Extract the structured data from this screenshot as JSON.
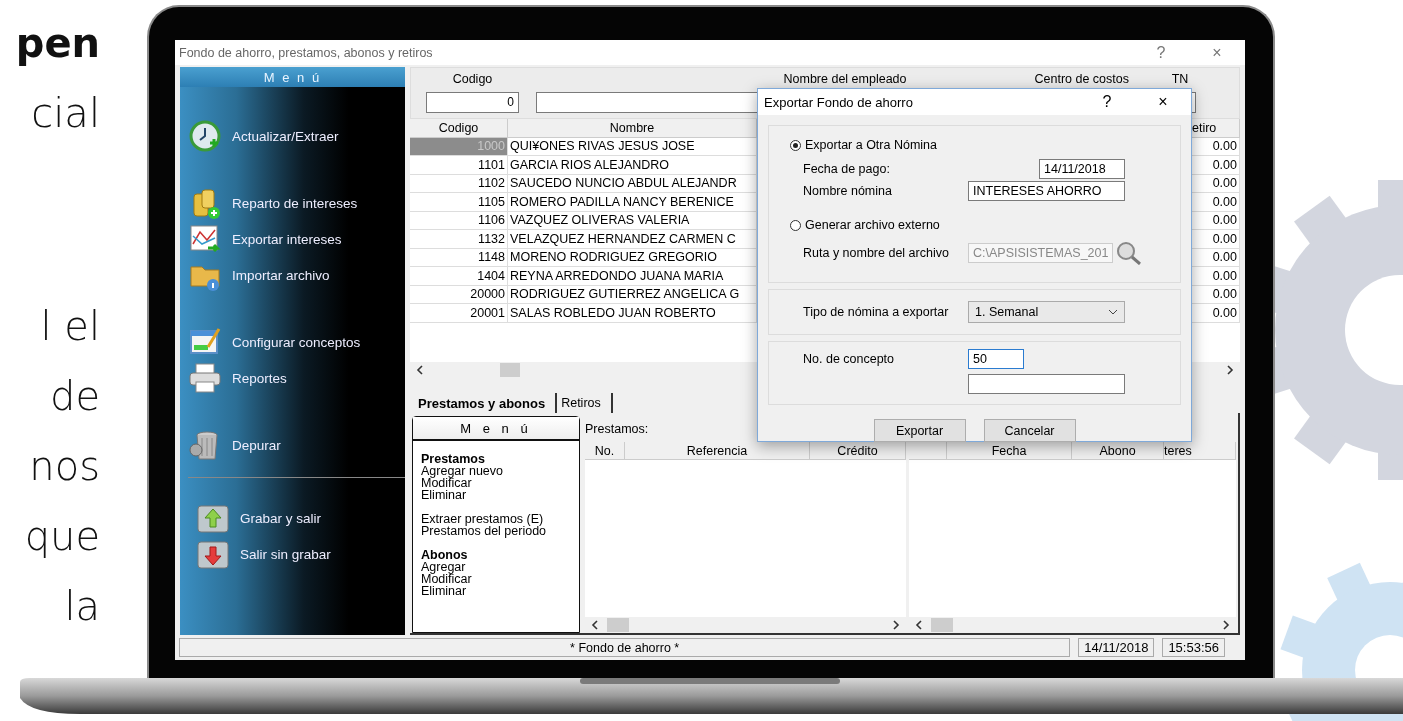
{
  "side_text": {
    "top_lines": [
      "pen",
      "cial"
    ],
    "bottom_lines": [
      "l el",
      "de",
      "nos",
      "que",
      "la"
    ]
  },
  "window": {
    "title": "Fondo de ahorro, prestamos, abonos y retiros",
    "help": "?",
    "close": "×"
  },
  "left_menu": {
    "title": "M e n ú",
    "groups": [
      {
        "separated": false,
        "items": [
          "Actualizar/Extraer"
        ]
      },
      {
        "separated": false,
        "items": [
          "Reparto de intereses",
          "Exportar intereses",
          "Importar archivo"
        ]
      },
      {
        "separated": false,
        "items": [
          "Configurar conceptos",
          "Reportes"
        ]
      },
      {
        "separated": false,
        "items": [
          "Depurar"
        ]
      },
      {
        "separated": true,
        "items": [
          "Grabar y salir",
          "Salir sin grabar"
        ]
      }
    ]
  },
  "employee_filter": [
    {
      "label": "Codigo",
      "value": "0"
    },
    {
      "label": "Nombre del empleado"
    },
    {
      "label": "Centro de costos"
    },
    {
      "label": "TN"
    }
  ],
  "employees": {
    "columns": [
      "Codigo",
      "Nombre",
      "etiro"
    ],
    "rows": [
      {
        "code": "1000",
        "name": "QUI¥ONES RIVAS JESUS JOSE",
        "retiro": "0.00",
        "selected": true
      },
      {
        "code": "1101",
        "name": "GARCIA RIOS ALEJANDRO",
        "retiro": "0.00",
        "selected": false
      },
      {
        "code": "1102",
        "name": "SAUCEDO NUNCIO ABDUL ALEJANDR",
        "retiro": "0.00",
        "selected": false
      },
      {
        "code": "1105",
        "name": "ROMERO PADILLA NANCY BERENICE",
        "retiro": "0.00",
        "selected": false
      },
      {
        "code": "1106",
        "name": "VAZQUEZ OLIVERAS VALERIA",
        "retiro": "0.00",
        "selected": false
      },
      {
        "code": "1132",
        "name": "VELAZQUEZ HERNANDEZ CARMEN C",
        "retiro": "0.00",
        "selected": false
      },
      {
        "code": "1148",
        "name": "MORENO RODRIGUEZ GREGORIO",
        "retiro": "0.00",
        "selected": false
      },
      {
        "code": "1404",
        "name": "REYNA ARREDONDO JUANA MARIA",
        "retiro": "0.00",
        "selected": false
      },
      {
        "code": "20000",
        "name": "RODRIGUEZ GUTIERREZ ANGELICA G",
        "retiro": "0.00",
        "selected": false
      },
      {
        "code": "20001",
        "name": "SALAS ROBLEDO JUAN ROBERTO",
        "retiro": "0.00",
        "selected": false
      }
    ]
  },
  "tabs": [
    {
      "label": "Prestamos y abonos",
      "selected": true
    },
    {
      "label": "Retiros",
      "selected": false
    }
  ],
  "loans_panel": {
    "menu_title": "M e n ú",
    "menu_groups": [
      {
        "title": "Prestamos",
        "items": [
          "Agregar nuevo",
          "Modificar",
          "Eliminar"
        ]
      },
      {
        "items": [
          "Extraer prestamos (E)",
          "Prestamos del periodo"
        ]
      },
      {
        "title": "Abonos",
        "items": [
          "Agregar",
          "Modificar",
          "Eliminar"
        ]
      }
    ],
    "label": "Prestamos:",
    "loans_columns": [
      "No.",
      "Referencia",
      "Crédito"
    ],
    "payments_columns": [
      "Fecha",
      "Abono",
      "teres"
    ]
  },
  "status_bar": {
    "message": "* Fondo de ahorro *",
    "date": "14/11/2018",
    "time": "15:53:56"
  },
  "dialog": {
    "title": "Exportar Fondo de ahorro",
    "help": "?",
    "close": "×",
    "options": [
      {
        "label": "Exportar a Otra Nómina",
        "selected": true
      },
      {
        "label": "Generar archivo externo",
        "selected": false
      }
    ],
    "fecha": {
      "label": "Fecha de pago:",
      "value": "14/11/2018"
    },
    "nombre": {
      "label": "Nombre nómina",
      "value": "INTERESES AHORRO"
    },
    "ruta": {
      "label": "Ruta y nombre del archivo",
      "value": "C:\\APSISISTEMAS_201",
      "disabled": true
    },
    "tipo": {
      "label": "Tipo de nómina a exportar",
      "value": "1. Semanal"
    },
    "concepto": {
      "label": "No. de concepto",
      "value": "50",
      "focused": true
    },
    "buttons": [
      "Exportar",
      "Cancelar"
    ]
  }
}
